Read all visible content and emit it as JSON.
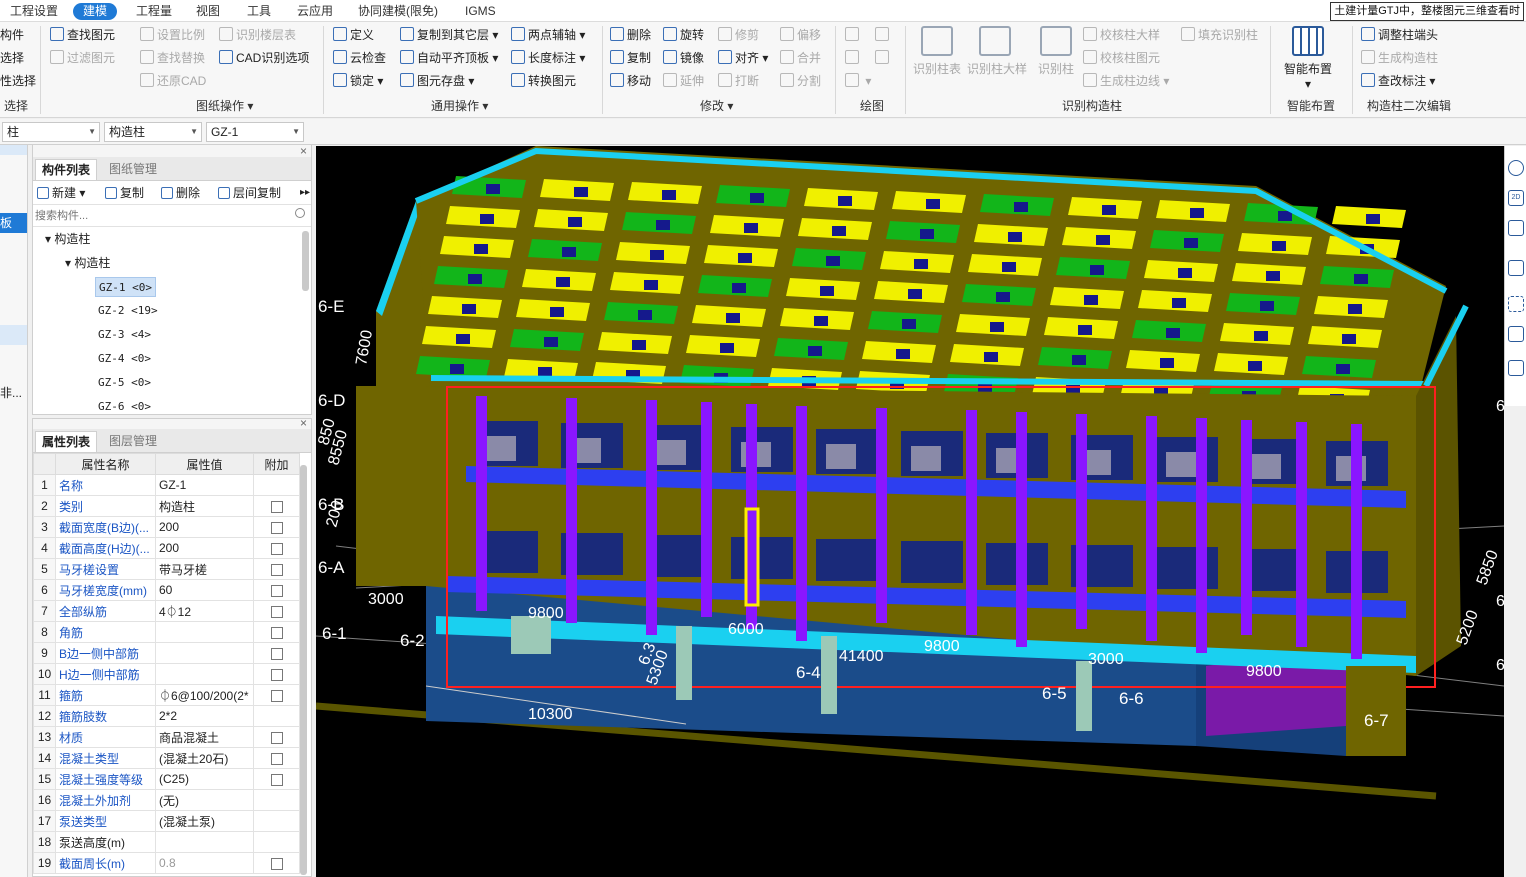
{
  "menu": {
    "items": [
      "工程设置",
      "建模",
      "工程量",
      "视图",
      "工具",
      "云应用",
      "协同建模(限免)",
      "IGMS"
    ],
    "active_index": 1,
    "notice": "土建计量GTJ中，整楼图元三维查看时"
  },
  "ribbon": {
    "select_group": {
      "items": [
        "构件",
        "选择",
        "性选择"
      ],
      "label": "选择"
    },
    "drawing_ops": {
      "items": [
        "查找图元",
        "过滤图元",
        "设置比例",
        "查找替换",
        "识别楼层表",
        "CAD识别选项",
        "还原CAD"
      ],
      "label": "图纸操作"
    },
    "general_ops": {
      "items": [
        "定义",
        "复制到其它层",
        "两点辅轴",
        "云检查",
        "自动平齐顶板",
        "长度标注",
        "锁定",
        "图元存盘",
        "转换图元"
      ],
      "label": "通用操作"
    },
    "modify": {
      "items": [
        "删除",
        "旋转",
        "修剪",
        "偏移",
        "复制",
        "镜像",
        "对齐",
        "合并",
        "移动",
        "延伸",
        "打断",
        "分割"
      ],
      "label": "修改"
    },
    "draw": {
      "label": "绘图"
    },
    "recognize_column": {
      "big_buttons": [
        "识别柱表",
        "识别柱大样",
        "识别柱"
      ],
      "items": [
        "校核柱大样",
        "填充识别柱",
        "校核柱图元",
        "生成柱边线"
      ],
      "label": "识别构造柱"
    },
    "smart_layout": {
      "button": "智能布置",
      "label": "智能布置"
    },
    "secondary_edit": {
      "items": [
        "调整柱端头",
        "生成构造柱",
        "查改标注"
      ],
      "label": "构造柱二次编辑"
    }
  },
  "selectors": {
    "category": "柱",
    "type": "构造柱",
    "component": "GZ-1"
  },
  "left_strip": {
    "items": [
      "板"
    ],
    "cut_text": "非..."
  },
  "component_panel": {
    "tabs": [
      "构件列表",
      "图纸管理"
    ],
    "toolbar": [
      "新建",
      "复制",
      "删除",
      "层间复制"
    ],
    "search_placeholder": "搜索构件...",
    "tree_root": "构造柱",
    "tree_child": "构造柱",
    "items": [
      "GZ-1 <0>",
      "GZ-2 <19>",
      "GZ-3 <4>",
      "GZ-4 <0>",
      "GZ-5 <0>",
      "GZ-6 <0>"
    ],
    "selected_index": 0
  },
  "property_panel": {
    "tabs": [
      "属性列表",
      "图层管理"
    ],
    "headers": [
      "属性名称",
      "属性值",
      "附加"
    ],
    "rows": [
      {
        "no": "1",
        "name": "名称",
        "value": "GZ-1",
        "blue": true,
        "checkbox": false
      },
      {
        "no": "2",
        "name": "类别",
        "value": "构造柱",
        "blue": true,
        "checkbox": true
      },
      {
        "no": "3",
        "name": "截面宽度(B边)(...",
        "value": "200",
        "blue": true,
        "checkbox": true
      },
      {
        "no": "4",
        "name": "截面高度(H边)(...",
        "value": "200",
        "blue": true,
        "checkbox": true
      },
      {
        "no": "5",
        "name": "马牙槎设置",
        "value": "带马牙槎",
        "blue": true,
        "checkbox": true
      },
      {
        "no": "6",
        "name": "马牙槎宽度(mm)",
        "value": "60",
        "blue": true,
        "checkbox": true
      },
      {
        "no": "7",
        "name": "全部纵筋",
        "value": "4⏀12",
        "blue": true,
        "checkbox": true
      },
      {
        "no": "8",
        "name": "角筋",
        "value": "",
        "blue": true,
        "checkbox": true
      },
      {
        "no": "9",
        "name": "B边一侧中部筋",
        "value": "",
        "blue": true,
        "checkbox": true
      },
      {
        "no": "10",
        "name": "H边一侧中部筋",
        "value": "",
        "blue": true,
        "checkbox": true
      },
      {
        "no": "11",
        "name": "箍筋",
        "value": "⏀6@100/200(2*",
        "blue": true,
        "checkbox": true
      },
      {
        "no": "12",
        "name": "箍筋肢数",
        "value": "2*2",
        "blue": true,
        "checkbox": false
      },
      {
        "no": "13",
        "name": "材质",
        "value": "商品混凝土",
        "blue": true,
        "checkbox": true
      },
      {
        "no": "14",
        "name": "混凝土类型",
        "value": "(混凝土20石)",
        "blue": true,
        "checkbox": true
      },
      {
        "no": "15",
        "name": "混凝土强度等级",
        "value": "(C25)",
        "blue": true,
        "checkbox": true
      },
      {
        "no": "16",
        "name": "混凝土外加剂",
        "value": "(无)",
        "blue": true,
        "checkbox": false
      },
      {
        "no": "17",
        "name": "泵送类型",
        "value": "(混凝土泵)",
        "blue": true,
        "checkbox": false
      },
      {
        "no": "18",
        "name": "泵送高度(m)",
        "value": "",
        "blue": false,
        "checkbox": false
      },
      {
        "no": "19",
        "name": "截面周长(m)",
        "value": "0.8",
        "blue": true,
        "checkbox": true,
        "grey": true
      }
    ]
  },
  "viewport": {
    "axis_labels": [
      "6-E",
      "6-D",
      "6-B",
      "6-A",
      "6-1",
      "6-2",
      "6-4",
      "6-5",
      "6-6",
      "6-7"
    ],
    "right_axis_labels": [
      "6-",
      "6-",
      "6-"
    ],
    "dimensions": [
      "7600",
      "8550",
      "200",
      "850",
      "3000",
      "9800",
      "6000",
      "9800",
      "41400",
      "3000",
      "9800",
      "10300",
      "5300",
      "5850",
      "5200",
      "6.3"
    ]
  },
  "colors": {
    "accent": "#1f7ad6",
    "wall_olive": "#6f6500",
    "beam_green": "#12b51a",
    "slab_yellow": "#f0f000",
    "column_purple": "#8a16ff",
    "beam_blue": "#2d3ff0",
    "cyan": "#1ad0f0",
    "selection_red": "#ff2020",
    "highlight_yellow": "#ffee00"
  }
}
